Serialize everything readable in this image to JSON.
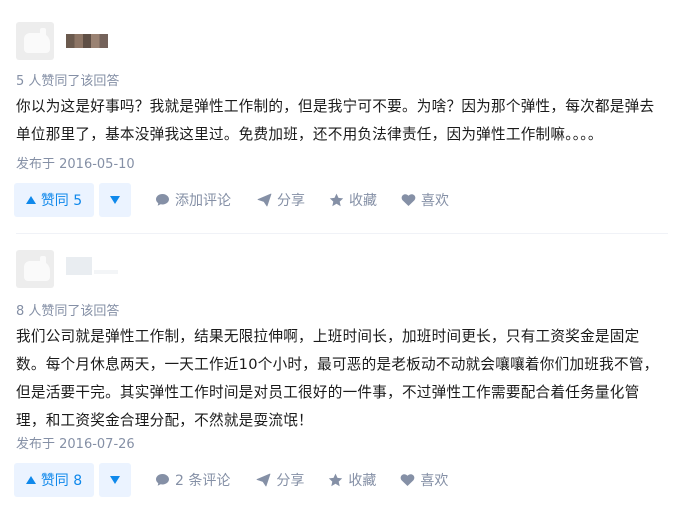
{
  "answers": [
    {
      "vote_summary": "5 人赞同了该回答",
      "content_lines": [
        "你以为这是好事吗？我就是弹性工作制的，但是我宁可不要。为啥？因为那个弹性，每次都是弹去",
        "单位那里了，基本没弹我这里过。免费加班，还不用负法律责任，因为弹性工作制嘛。。。。"
      ],
      "publish_time": "发布于 2016-05-10",
      "vote_up_label": "赞同 5",
      "comment_label": "添加评论",
      "share_label": "分享",
      "favorite_label": "收藏",
      "like_label": "喜欢"
    },
    {
      "vote_summary": "8 人赞同了该回答",
      "content_lines": [
        "我们公司就是弹性工作制，结果无限拉伸啊，上班时间长，加班时间更长，只有工资奖金是固定",
        "数。每个月休息两天，一天工作近10个小时，最可恶的是老板动不动就会嚷嚷着你们加班我不管，",
        "但是活要干完。其实弹性工作时间是对员工很好的一件事，不过弹性工作需要配合着任务量化管",
        "理，和工资奖金合理分配，不然就是耍流氓！"
      ],
      "publish_time": "发布于 2016-07-26",
      "vote_up_label": "赞同 8",
      "comment_label": "2 条评论",
      "share_label": "分享",
      "favorite_label": "收藏",
      "like_label": "喜欢"
    }
  ],
  "colors": {
    "accent": "#0f88eb",
    "vote_bg": "#ebf3ff",
    "meta_text": "#8590a6"
  },
  "icons": [
    "comment-icon",
    "share-icon",
    "star-icon",
    "heart-icon",
    "vote-up-icon",
    "vote-down-icon"
  ]
}
